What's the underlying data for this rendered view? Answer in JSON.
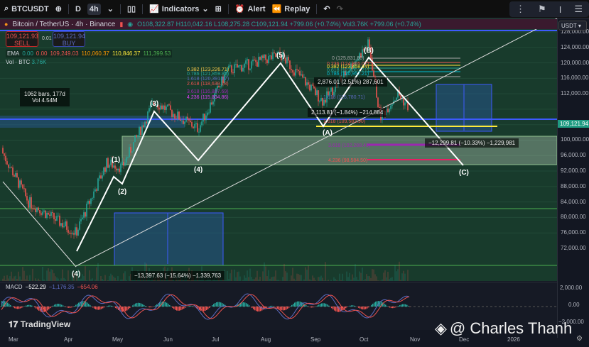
{
  "toolbar": {
    "symbol": "BTCUSDT",
    "interval_d": "D",
    "interval_active": "4h",
    "indicators": "Indicators",
    "alert": "Alert",
    "replay": "Replay"
  },
  "legend": {
    "title": "Bitcoin / TetherUS · 4h · Binance",
    "ohlc": "O108,322.87 H110,042.16 L108,275.28 C109,121.94 +799.06 (+0.74%) Vol3.76K +799.06 (+0.74%)"
  },
  "trade": {
    "sell_price": "109,121.93",
    "sell": "SELL",
    "spread": "0.01",
    "buy_price": "109,121.94",
    "buy": "BUY"
  },
  "ema": {
    "label": "EMA",
    "values": [
      "0.00",
      "0.00",
      "109,249.03",
      "110,060.37",
      "110,846.37",
      "111,399.53"
    ],
    "colors": [
      "#26a69a",
      "#ef5350",
      "#ef5350",
      "#ff9800",
      "#ffeb3b",
      "#4caf50"
    ]
  },
  "volume": {
    "label": "Vol · BTC",
    "value": "3.76K"
  },
  "axis": {
    "currency": "USDT",
    "current_price": "109,121.94",
    "ticks": [
      128000,
      124000,
      120000,
      116000,
      112000,
      104000,
      100000,
      96000,
      92000,
      88000,
      84000,
      80000,
      76000,
      72000
    ],
    "tick_labels": [
      "128,000.00",
      "124,000.00",
      "120,000.00",
      "116,000.00",
      "112,000.00",
      "104,000.00",
      "100,000.00",
      "96,000.00",
      "92,000.00",
      "88,000.00",
      "84,000.00",
      "80,000.00",
      "76,000.00",
      "72,000.00"
    ]
  },
  "waves": [
    "(1)",
    "(2)",
    "(3)",
    "(4)",
    "(5)",
    "(A)",
    "(B)",
    "(C)",
    "(4)"
  ],
  "measures": {
    "range_bars": "1062 bars, 177d",
    "range_vol": "Vol 4.54M",
    "drop1": "−13,397.63 (−15.64%) −1,339,763",
    "drop2": "−12,299.81 (−10.33%) −1,229,981",
    "up1": "2,876.01 (2.51%) 287,601",
    "down1": "2,113.81 (−1.84%) −214,884"
  },
  "fib_left": [
    "0.382 (123,226.71)",
    "0.786 (121,859.87)",
    "1.618 (120,391.87)",
    "2.618 (118,639.78)",
    "3.618 (116,887.69)",
    "4.236 (115,804.86)"
  ],
  "fib_right": [
    "0 (125,831.80)",
    "0.236 (124,365.07)",
    "0.382 (123,458.44)",
    "0.618 (122,001.21)",
    "0.786 (120,957.21)",
    "1.618 (116,780.71)",
    "1.618 (109,583.90)",
    "3.618 (102,288.40)",
    "4.236 (98,584.50)"
  ],
  "macd": {
    "label": "MACD",
    "v1": "−522.29",
    "v2": "−1,176.35",
    "v3": "−654.06",
    "ticks": [
      "2,000.00",
      "0.00",
      "−2,000.00"
    ]
  },
  "time_axis": [
    "Mar",
    "Apr",
    "May",
    "Jun",
    "Jul",
    "Aug",
    "Sep",
    "Oct",
    "Nov",
    "Dec",
    "2026"
  ],
  "branding": {
    "tradingview": "TradingView",
    "watermark": "@ Charles Thanh"
  }
}
